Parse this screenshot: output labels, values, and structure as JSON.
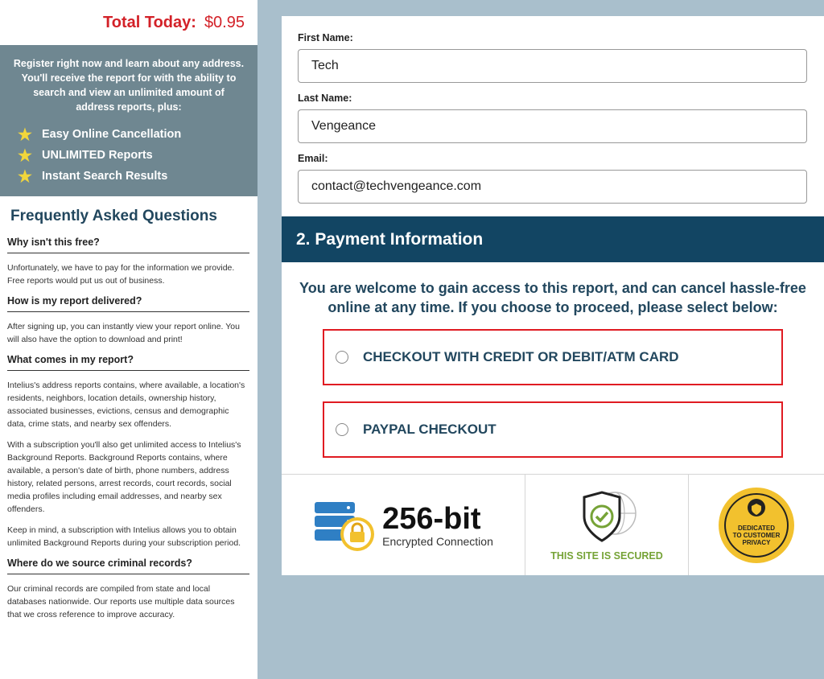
{
  "summary": {
    "total_label": "Total Today:",
    "total_value": "$0.95"
  },
  "promo": {
    "text": "Register right now and learn about any address. You'll receive the report for with the ability to search and view an unlimited amount of address reports, plus:",
    "benefits": [
      "Easy Online Cancellation",
      "UNLIMITED Reports",
      "Instant Search Results"
    ]
  },
  "faq": {
    "title": "Frequently Asked Questions",
    "items": [
      {
        "q": "Why isn't this free?",
        "a": [
          "Unfortunately, we have to pay for the information we provide. Free reports would put us out of business."
        ]
      },
      {
        "q": "How is my report delivered?",
        "a": [
          "After signing up, you can instantly view your report online. You will also have the option to download and print!"
        ]
      },
      {
        "q": "What comes in my report?",
        "a": [
          "Intelius's address reports contains, where available, a location's residents, neighbors, location details, ownership history, associated businesses, evictions, census and demographic data, crime stats, and nearby sex offenders.",
          "With a subscription you'll also get unlimited access to Intelius's Background Reports. Background Reports contains, where available, a person's date of birth, phone numbers, address history, related persons, arrest records, court records, social media profiles including email addresses, and nearby sex offenders.",
          "Keep in mind, a subscription with Intelius allows you to obtain unlimited Background Reports during your subscription period."
        ]
      },
      {
        "q": "Where do we source criminal records?",
        "a": [
          "Our criminal records are compiled from state and local databases nationwide. Our reports use multiple data sources that we cross reference to improve accuracy."
        ]
      }
    ]
  },
  "form": {
    "first_name_label": "First Name:",
    "first_name_value": "Tech",
    "last_name_label": "Last Name:",
    "last_name_value": "Vengeance",
    "email_label": "Email:",
    "email_value": "contact@techvengeance.com"
  },
  "payment": {
    "header": "2. Payment Information",
    "welcome": "You are welcome to gain access to this report, and can cancel hassle-free online at any time. If you choose to proceed, please select below:",
    "option_card": "CHECKOUT WITH CREDIT OR DEBIT/ATM CARD",
    "option_paypal": "PAYPAL CHECKOUT"
  },
  "trust": {
    "bits": "256-bit",
    "bits_sub": "Encrypted Connection",
    "secured": "THIS SITE IS SECURED",
    "badge_lines": [
      "DEDICATED",
      "TO CUSTOMER",
      "PRIVACY"
    ]
  },
  "colors": {
    "accent_red": "#d32128",
    "navy": "#124563",
    "page_bg": "#a9bfcc",
    "secured_green": "#76a337",
    "badge_gold": "#f2c12e"
  }
}
